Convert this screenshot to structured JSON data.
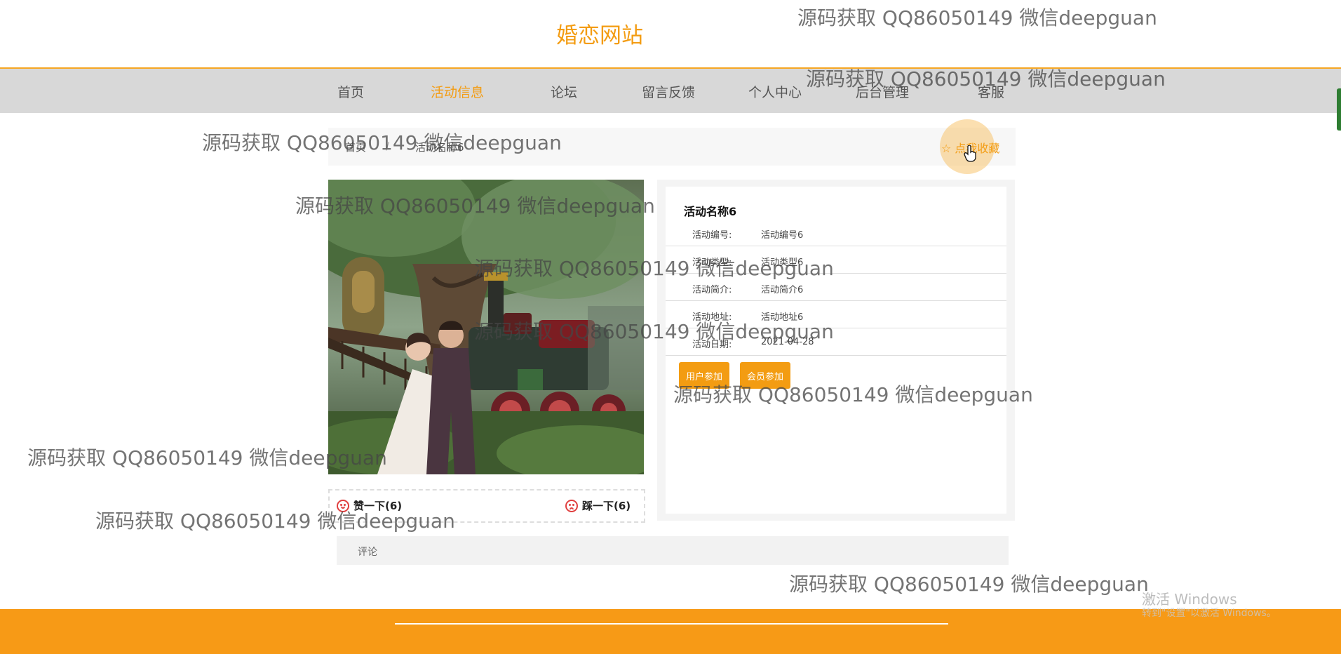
{
  "site": {
    "title": "婚恋网站"
  },
  "nav": [
    {
      "label": "首页",
      "active": false
    },
    {
      "label": "活动信息",
      "active": true
    },
    {
      "label": "论坛",
      "active": false
    },
    {
      "label": "留言反馈",
      "active": false
    },
    {
      "label": "个人中心",
      "active": false
    },
    {
      "label": "后台管理",
      "active": false
    },
    {
      "label": "客服",
      "active": false
    }
  ],
  "breadcrumb": {
    "home": "首页",
    "separator": "/",
    "current": "活动名称6"
  },
  "favorite": {
    "label": "☆ 点我收藏"
  },
  "votes": {
    "like": "赞一下(6)",
    "dislike": "踩一下(6)"
  },
  "detail": {
    "title": "活动名称6",
    "rows": [
      {
        "label": "活动编号:",
        "value": "活动编号6"
      },
      {
        "label": "活动类型:",
        "value": "活动类型6"
      },
      {
        "label": "活动简介:",
        "value": "活动简介6"
      },
      {
        "label": "活动地址:",
        "value": "活动地址6"
      },
      {
        "label": "活动日期:",
        "value": "2021-04-28"
      }
    ],
    "buttons": {
      "user_join": "用户参加",
      "member_join": "会员参加"
    }
  },
  "comment": {
    "label": "评论"
  },
  "watermark": "源码获取 QQ86050149 微信deepguan",
  "windows_activation": {
    "title": "激活 Windows",
    "subtitle": "转到\"设置\"以激活 Windows。"
  },
  "colors": {
    "accent": "#f39c12",
    "nav_bg": "#d8d8d8",
    "footer": "#f79a16"
  }
}
